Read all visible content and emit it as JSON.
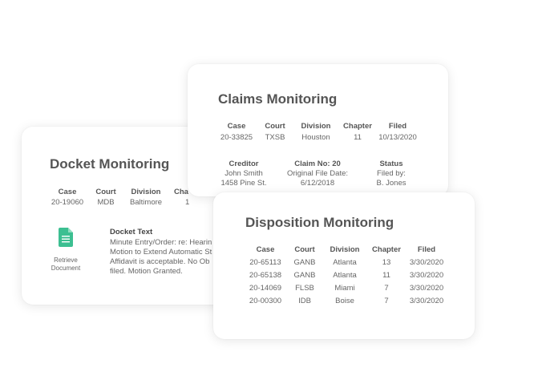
{
  "docket": {
    "title": "Docket Monitoring",
    "headers": [
      "Case",
      "Court",
      "Division",
      "Cha"
    ],
    "row": [
      "20-19060",
      "MDB",
      "Baltimore",
      "1"
    ],
    "retrieve_label_1": "Retrieve",
    "retrieve_label_2": "Document",
    "docket_text_label": "Docket Text",
    "docket_text_lines": [
      "Minute Entry/Order: re: Hearin",
      "Motion to Extend Automatic St",
      "Affidavit is acceptable. No Ob",
      "filed. Motion Granted."
    ],
    "icon": "document-icon",
    "icon_color": "#3cbf91"
  },
  "claims": {
    "title": "Claims Monitoring",
    "headers": [
      "Case",
      "Court",
      "Division",
      "Chapter",
      "Filed"
    ],
    "row": [
      "20-33825",
      "TXSB",
      "Houston",
      "11",
      "10/13/2020"
    ],
    "creditor_header": "Creditor",
    "creditor_lines": [
      "John Smith",
      "1458 Pine St."
    ],
    "claim_header": "Claim No: 20",
    "claim_lines": [
      "Original File Date:",
      "6/12/2018"
    ],
    "status_header": "Status",
    "status_lines": [
      "Filed by:",
      "B. Jones"
    ]
  },
  "disposition": {
    "title": "Disposition Monitoring",
    "headers": [
      "Case",
      "Court",
      "Division",
      "Chapter",
      "Filed"
    ],
    "rows": [
      [
        "20-65113",
        "GANB",
        "Atlanta",
        "13",
        "3/30/2020"
      ],
      [
        "20-65138",
        "GANB",
        "Atlanta",
        "11",
        "3/30/2020"
      ],
      [
        "20-14069",
        "FLSB",
        "Miami",
        "7",
        "3/30/2020"
      ],
      [
        "20-00300",
        "IDB",
        "Boise",
        "7",
        "3/30/2020"
      ]
    ]
  }
}
